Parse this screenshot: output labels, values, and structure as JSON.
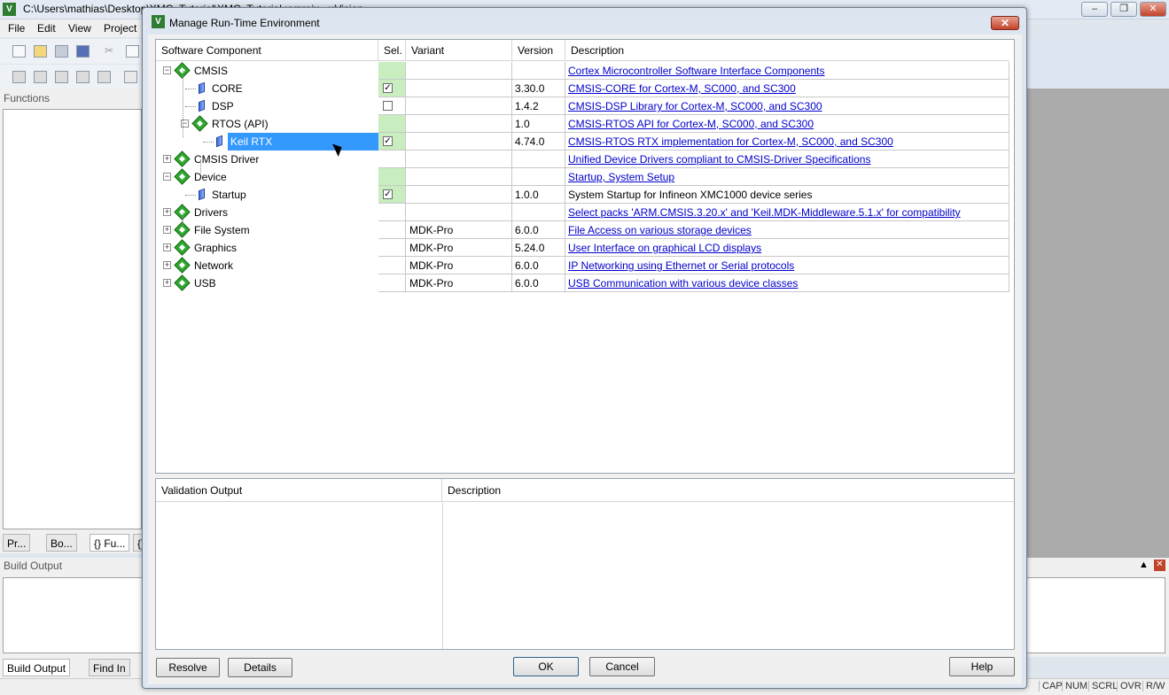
{
  "main_window": {
    "title": "C:\\Users\\mathias\\Desktop\\XMC_Tutorial\\XMC_Tutorial.uvprojx - µVision",
    "menu": [
      "File",
      "Edit",
      "View",
      "Project"
    ],
    "functions_panel_title": "Functions",
    "functions_tabs": [
      "Pr...",
      "Bo...",
      "{} Fu...",
      "{}"
    ],
    "build_output_title": "Build Output",
    "build_tabs": [
      "Build Output",
      "Find In"
    ],
    "status": [
      "CAP",
      "NUM",
      "SCRL",
      "OVR",
      "R/W"
    ]
  },
  "dialog": {
    "title": "Manage Run-Time Environment",
    "close_glyph": "✕",
    "columns": {
      "component": "Software Component",
      "sel": "Sel.",
      "variant": "Variant",
      "version": "Version",
      "description": "Description"
    },
    "rows": [
      {
        "name": "CMSIS",
        "level": 0,
        "expander": "−",
        "kind": "group",
        "sel": "",
        "sel_green": true,
        "variant": "",
        "version": "",
        "description": "Cortex Microcontroller Software Interface Components",
        "link": true
      },
      {
        "name": "CORE",
        "level": 1,
        "expander": "",
        "kind": "item",
        "sel": "✓",
        "sel_green": true,
        "variant": "",
        "version": "3.30.0",
        "description": "CMSIS-CORE for Cortex-M, SC000, and SC300",
        "link": true
      },
      {
        "name": "DSP",
        "level": 1,
        "expander": "",
        "kind": "item",
        "sel": "",
        "checkbox": true,
        "sel_green": false,
        "variant": "",
        "version": "1.4.2",
        "description": "CMSIS-DSP Library for Cortex-M, SC000, and SC300",
        "link": true
      },
      {
        "name": "RTOS (API)",
        "level": 1,
        "expander": "−",
        "kind": "group",
        "sel": "",
        "sel_green": true,
        "variant": "",
        "version": "1.0",
        "description": "CMSIS-RTOS API for Cortex-M, SC000, and SC300",
        "link": true
      },
      {
        "name": "Keil RTX",
        "level": 2,
        "expander": "",
        "kind": "item",
        "sel": "✓",
        "sel_green": true,
        "selected": true,
        "variant": "",
        "version": "4.74.0",
        "description": "CMSIS-RTOS RTX implementation for Cortex-M, SC000, and SC300",
        "link": true
      },
      {
        "name": "CMSIS Driver",
        "level": 0,
        "expander": "+",
        "kind": "group",
        "sel": "",
        "sel_green": false,
        "variant": "",
        "version": "",
        "description": "Unified Device Drivers compliant to CMSIS-Driver Specifications",
        "link": true
      },
      {
        "name": "Device",
        "level": 0,
        "expander": "−",
        "kind": "group",
        "sel": "",
        "sel_green": true,
        "variant": "",
        "version": "",
        "description": "Startup, System Setup",
        "link": true
      },
      {
        "name": "Startup",
        "level": 1,
        "expander": "",
        "kind": "item",
        "sel": "✓",
        "sel_green": true,
        "variant": "",
        "version": "1.0.0",
        "description": "System Startup for Infineon XMC1000 device series",
        "link": false
      },
      {
        "name": "Drivers",
        "level": 0,
        "expander": "+",
        "kind": "group",
        "sel": "",
        "sel_green": false,
        "variant": "",
        "version": "",
        "description": "Select packs 'ARM.CMSIS.3.20.x' and 'Keil.MDK-Middleware.5.1.x' for compatibility",
        "link": true
      },
      {
        "name": "File System",
        "level": 0,
        "expander": "+",
        "kind": "group",
        "sel": "",
        "sel_green": false,
        "variant": "MDK-Pro",
        "version": "6.0.0",
        "description": "File Access on various storage devices",
        "link": true
      },
      {
        "name": "Graphics",
        "level": 0,
        "expander": "+",
        "kind": "group",
        "sel": "",
        "sel_green": false,
        "variant": "MDK-Pro",
        "version": "5.24.0",
        "description": "User Interface on graphical LCD displays",
        "link": true
      },
      {
        "name": "Network",
        "level": 0,
        "expander": "+",
        "kind": "group",
        "sel": "",
        "sel_green": false,
        "variant": "MDK-Pro",
        "version": "6.0.0",
        "description": "IP Networking using Ethernet or Serial protocols",
        "link": true
      },
      {
        "name": "USB",
        "level": 0,
        "expander": "+",
        "kind": "group",
        "sel": "",
        "sel_green": false,
        "variant": "MDK-Pro",
        "version": "6.0.0",
        "description": "USB Communication with various device classes",
        "link": true
      }
    ],
    "validation": {
      "col_output": "Validation Output",
      "col_description": "Description"
    },
    "buttons": {
      "resolve": "Resolve",
      "details": "Details",
      "ok": "OK",
      "cancel": "Cancel",
      "help": "Help"
    }
  },
  "colors": {
    "sel_green": "#c8eec0",
    "selection_blue": "#3399ff",
    "link": "#0000cc"
  }
}
